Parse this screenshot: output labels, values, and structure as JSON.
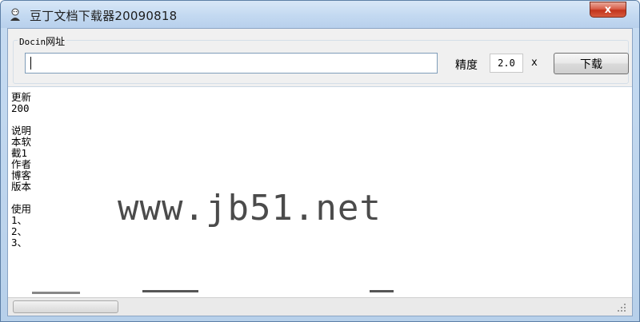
{
  "window": {
    "title": "豆丁文档下载器20090818",
    "close_glyph": "x"
  },
  "form": {
    "url_legend_prefix": "Docin",
    "url_legend_suffix": "网址",
    "url_value": "",
    "precision_label": "精度",
    "precision_value": "2.0",
    "multiplier": "x",
    "download_label": "下载"
  },
  "log_lines": [
    {
      "text": "更新"
    },
    {
      "text": "200"
    },
    {
      "text": ""
    },
    {
      "text": "说明"
    },
    {
      "text": "本软"
    },
    {
      "text": "截1"
    },
    {
      "text": "作者"
    },
    {
      "text": "博客"
    },
    {
      "text": "版本"
    },
    {
      "text": ""
    },
    {
      "text": "使用"
    },
    {
      "text": "1、"
    },
    {
      "text": "2、"
    },
    {
      "text": "3、"
    }
  ],
  "watermark": "www.jb51.net",
  "colors": {
    "accent": "#7f9db9",
    "close": "#c2331c"
  }
}
